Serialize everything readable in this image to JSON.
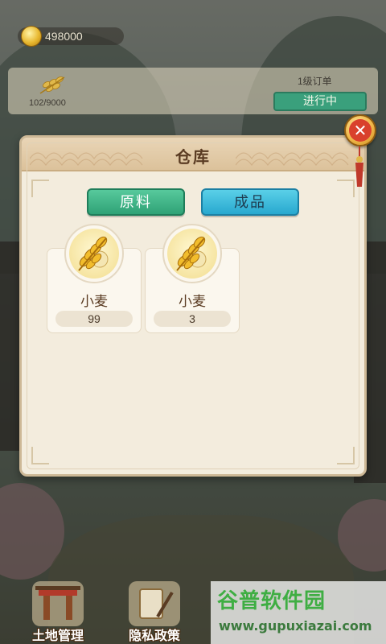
{
  "hud": {
    "coins": "498000"
  },
  "order": {
    "progress": "102/9000",
    "level": "1级订单",
    "status": "进行中"
  },
  "dialog": {
    "title": "仓库",
    "close_glyph": "✕",
    "tabs": [
      {
        "label": "原料",
        "active": true
      },
      {
        "label": "成品",
        "active": false
      }
    ],
    "items": [
      {
        "name": "小麦",
        "quantity": "99",
        "icon": "wheat-icon"
      },
      {
        "name": "小麦",
        "quantity": "3",
        "icon": "wheat-icon"
      }
    ]
  },
  "bottom_nav": [
    {
      "label": "土地管理",
      "icon": "gate-icon"
    },
    {
      "label": "隐私政策",
      "icon": "scroll-icon"
    }
  ],
  "watermark": {
    "title": "谷普软件园",
    "url": "www.gupuxiazai.com"
  },
  "colors": {
    "tab_materials": "#2fa276",
    "tab_products": "#28a8cf",
    "dialog_bg": "#f3ecdd",
    "title_text": "#5a3b22",
    "watermark_green": "#3fae43"
  }
}
